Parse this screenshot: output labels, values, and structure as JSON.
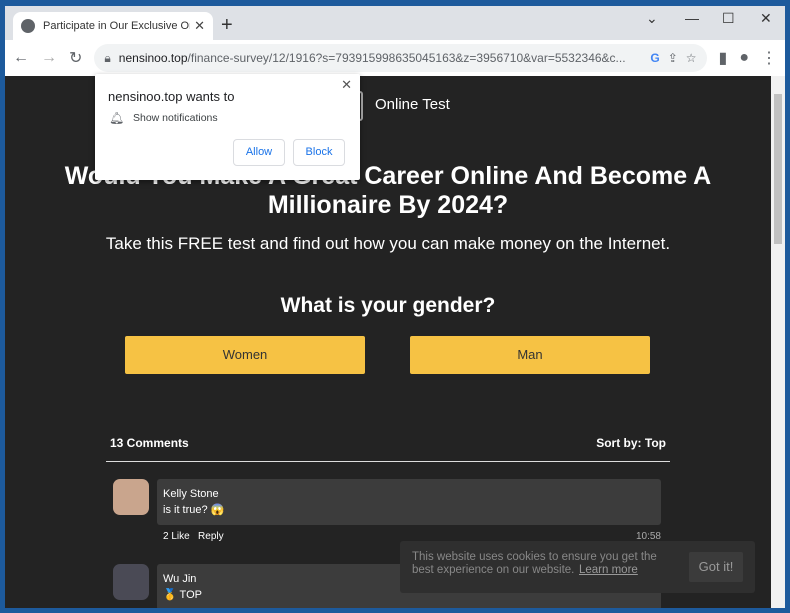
{
  "browser": {
    "tab_title": "Participate in Our Exclusive Onlin",
    "url_host": "nensinoo.top",
    "url_path": "/finance-survey/12/1916?s=793915998635045163&z=3956710&var=5532346&c..."
  },
  "popup": {
    "title": "nensinoo.top wants to",
    "permission": "Show notifications",
    "allow": "Allow",
    "block": "Block"
  },
  "page": {
    "brand": "Online Test",
    "headline": "Would You Make A Great Career Online And Become A Millionaire By 2024?",
    "subtitle": "Take this FREE test and find out how you can make money on the Internet.",
    "question": "What is your gender?",
    "options": [
      "Women",
      "Man"
    ]
  },
  "comments": {
    "count": "13 Comments",
    "sort": "Sort by: Top",
    "items": [
      {
        "name": "Kelly Stone",
        "text": "is it true? 😱",
        "likes": "2 Like",
        "reply": "Reply",
        "time": "10:58"
      },
      {
        "name": "Wu Jin",
        "text": "🥇 TOP"
      }
    ]
  },
  "cookie": {
    "text": "This website uses cookies to ensure you get the best experience on our website.",
    "link": "Learn more",
    "button": "Got it!"
  },
  "colors": {
    "accent": "#f6c244",
    "background": "#232323",
    "frame": "#1d5a9c"
  }
}
